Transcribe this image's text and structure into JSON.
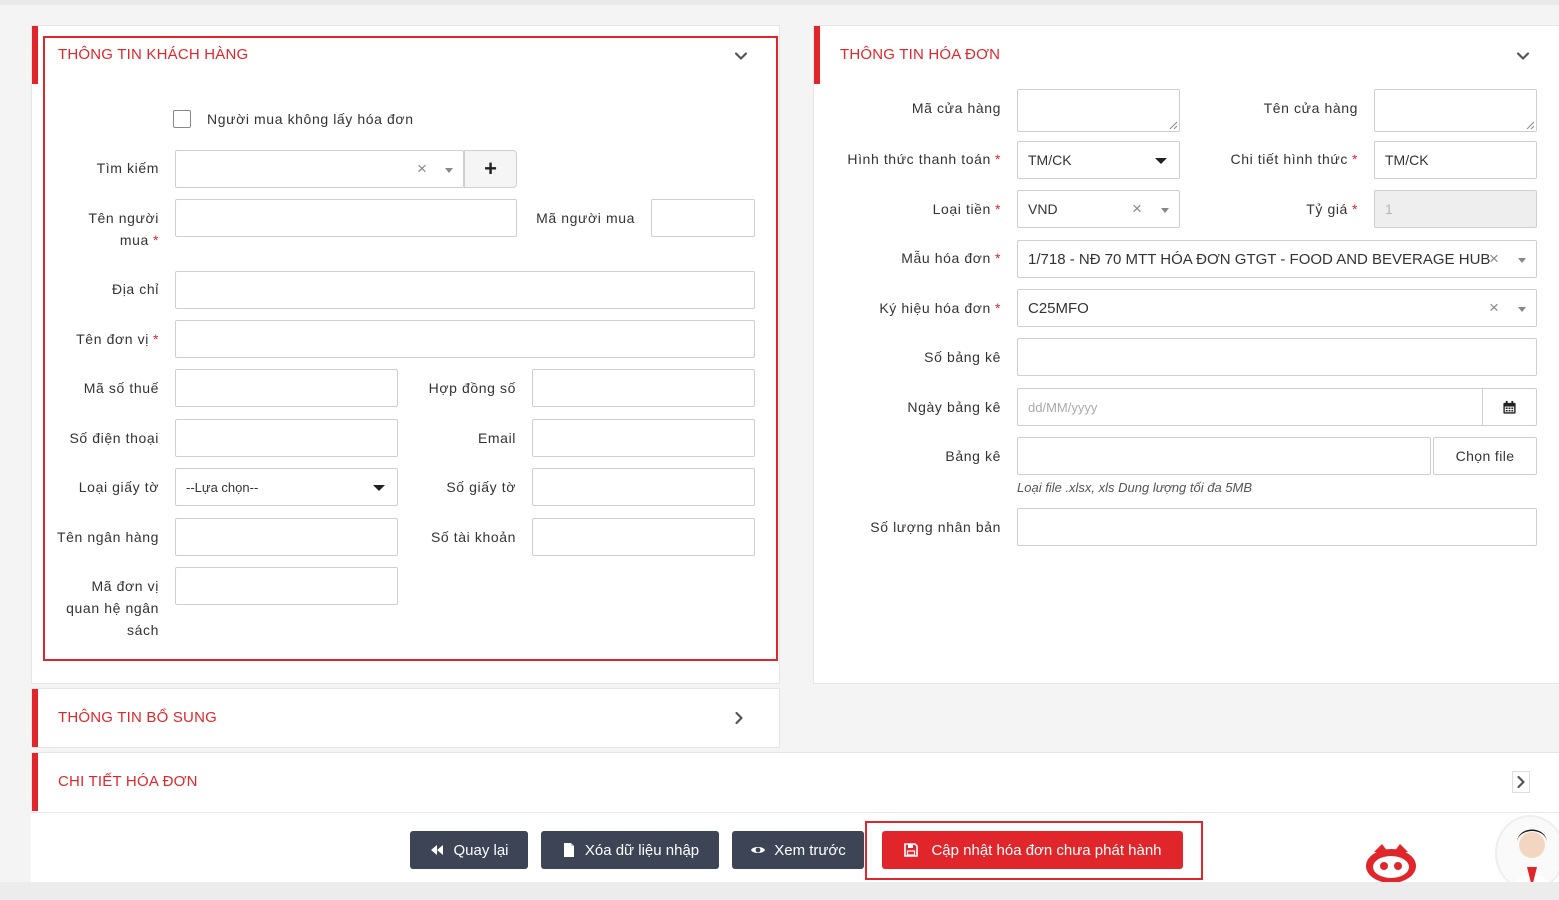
{
  "customer_panel": {
    "title": "THÔNG TIN KHÁCH HÀNG",
    "no_invoice_checkbox_label": "Người mua không lấy hóa đơn",
    "search_label": "Tìm kiếm",
    "search_clear": "×",
    "add_button": "+",
    "buyer_name_label_1": "Tên người",
    "buyer_name_label_2": "mua",
    "buyer_code_label": "Mã người mua",
    "address_label": "Địa chỉ",
    "unit_name_label": "Tên đơn vị",
    "tax_code_label": "Mã số thuế",
    "contract_no_label": "Hợp đồng số",
    "phone_label": "Số điện thoại",
    "email_label": "Email",
    "doc_type_label": "Loại giấy tờ",
    "doc_type_value": "--Lựa chọn--",
    "doc_no_label": "Số giấy tờ",
    "bank_name_label": "Tên ngân hàng",
    "account_no_label": "Số tài khoản",
    "budget_unit_label_1": "Mã đơn vị",
    "budget_unit_label_2": "quan hệ ngân",
    "budget_unit_label_3": "sách",
    "required_mark": "*"
  },
  "invoice_panel": {
    "title": "THÔNG TIN HÓA ĐƠN",
    "store_code_label": "Mã cửa hàng",
    "store_name_label": "Tên cửa hàng",
    "payment_method_label": "Hình thức thanh toán",
    "payment_method_value": "TM/CK",
    "payment_detail_label": "Chi tiết hình thức",
    "payment_detail_value": "TM/CK",
    "currency_label": "Loại tiền",
    "currency_value": "VND",
    "exchange_rate_label": "Tỷ giá",
    "exchange_rate_value": "1",
    "template_label": "Mẫu hóa đơn",
    "template_value": "1/718 - NĐ 70 MTT HÓA ĐƠN GTGT - FOOD AND BEVERAGE HUB",
    "symbol_label": "Ký hiệu hóa đơn",
    "symbol_value": "C25MFO",
    "list_no_label": "Số bảng kê",
    "list_date_label": "Ngày bảng kê",
    "list_date_placeholder": "dd/MM/yyyy",
    "list_file_label": "Bảng kê",
    "choose_file_button": "Chọn file",
    "file_hint": "Loại file .xlsx, xls Dung lượng tối đa 5MB",
    "copies_label": "Số lượng nhân bản",
    "clear_mark": "×",
    "required_mark": "*"
  },
  "extra_panel": {
    "title": "THÔNG TIN BỔ SUNG"
  },
  "detail_panel": {
    "title": "CHI TIẾT HÓA ĐƠN"
  },
  "actions": {
    "back": "Quay lại",
    "clear_input": "Xóa dữ liệu nhập",
    "preview": "Xem trước",
    "update_unissued": "Cập nhật hóa đơn chưa phát hành"
  },
  "colors": {
    "accent": "#e0262b",
    "dark_button": "#3c4456"
  }
}
